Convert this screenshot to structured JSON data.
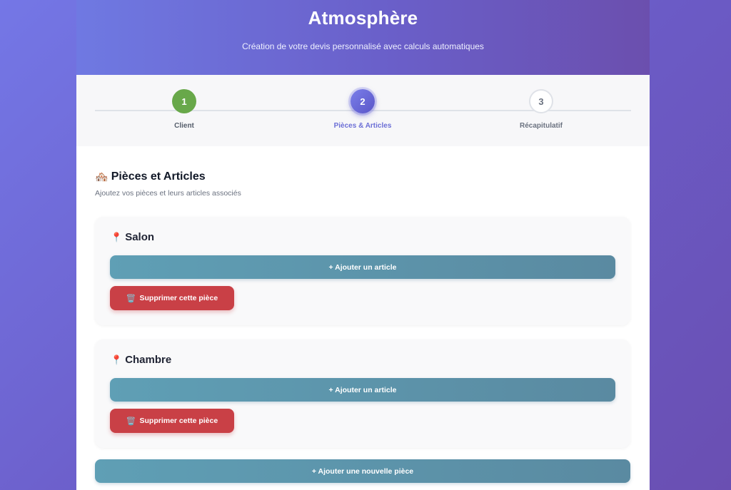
{
  "header": {
    "title": "Atmosphère",
    "subtitle": "Création de votre devis personnalisé avec calculs automatiques"
  },
  "steps": [
    {
      "number": "1",
      "label": "Client",
      "state": "done"
    },
    {
      "number": "2",
      "label": "Pièces & Articles",
      "state": "active"
    },
    {
      "number": "3",
      "label": "Récapitulatif",
      "state": "todo"
    }
  ],
  "section": {
    "icon": "🏘️",
    "title": "Pièces et Articles",
    "subtitle": "Ajoutez vos pièces et leurs articles associés"
  },
  "rooms": [
    {
      "icon": "📍",
      "name": "Salon",
      "add_label": "+ Ajouter un article",
      "delete_icon": "🗑️",
      "delete_label": "Supprimer cette pièce"
    },
    {
      "icon": "📍",
      "name": "Chambre",
      "add_label": "+ Ajouter un article",
      "delete_icon": "🗑️",
      "delete_label": "Supprimer cette pièce"
    }
  ],
  "add_room_label": "+ Ajouter une nouvelle pièce",
  "colors": {
    "brand_gradient_start": "#7477e6",
    "brand_gradient_end": "#6a4fb2",
    "step_done": "#68a84a",
    "step_active": "#6c6fd6",
    "add_button": "#5f9fb5",
    "delete_button": "#c94046"
  }
}
